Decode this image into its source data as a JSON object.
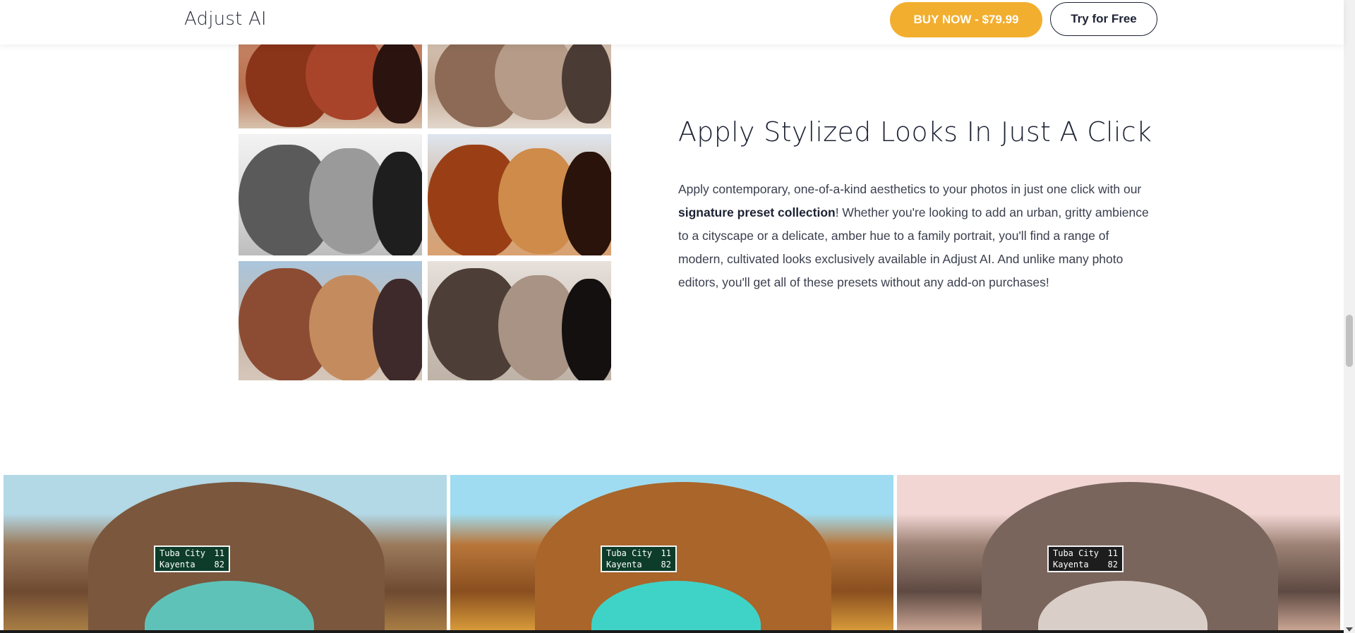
{
  "header": {
    "logo": "Adjust AI",
    "buy_button": "BUY NOW - $79.99",
    "try_button": "Try for Free"
  },
  "feature": {
    "title": "Apply Stylized Looks In Just A Click",
    "body_part1": "Apply contemporary, one-of-a-kind aesthetics to your photos in just one click with our ",
    "body_bold": "signature preset collection",
    "body_part2": "! Whether you're looking to add an urban, gritty ambience to a cityscape or a delicate, amber hue to a family portrait, you'll find a range of modern, cultivated looks exclusively available in Adjust AI. And unlike many photo editors, you'll get all of these presets without any add-on purchases!"
  },
  "road_sign": {
    "line1_city": "Tuba City",
    "line1_miles": "11",
    "line2_city": "Kayenta",
    "line2_miles": "82"
  },
  "colors": {
    "accent": "#f2ae2e",
    "text_dark": "#1d2233"
  }
}
